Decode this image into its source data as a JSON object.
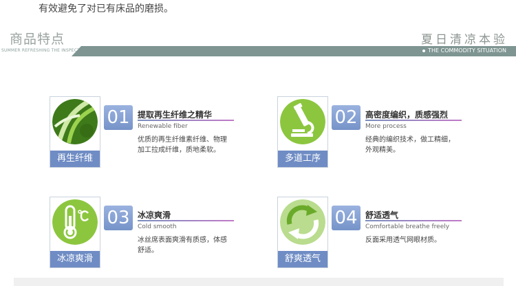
{
  "intro_text": "有效避免了对已有床品的磨损。",
  "header": {
    "title": "商品特点",
    "slogan": "夏日清凉本验",
    "band_left": "SUMMER REFRESHING THE INSPECTION",
    "band_right": "THE COMMODITY SITUATION"
  },
  "features": [
    {
      "icon": "leaf-icon",
      "label": "再生纤维",
      "number": "01",
      "title": "提取再生纤维之精华",
      "subtitle": "Renewable fiber",
      "desc": "优质的再生纤维素纤维、物理加工拉成纤维，质地柔软。"
    },
    {
      "icon": "microscope-icon",
      "label": "多道工序",
      "number": "02",
      "title": "高密度编织，质感强烈",
      "subtitle": "More process",
      "desc": "经典的编织技术，做工精细，外观精美。"
    },
    {
      "icon": "thermometer-icon",
      "label": "冰凉爽滑",
      "number": "03",
      "title": "冰凉爽滑",
      "subtitle": "Cold smooth",
      "desc": "冰丝席表面爽滑有质感，体感舒适。"
    },
    {
      "icon": "recycle-arrows-icon",
      "label": "舒爽透气",
      "number": "04",
      "title": "舒适透气",
      "subtitle": "Comfortable breathe freely",
      "desc": "反面采用透气网眼材质。"
    }
  ],
  "colors": {
    "accent_blue": "#6f8cc4",
    "band_gray": "#7e9591",
    "icon_green": "#8cc63f"
  }
}
